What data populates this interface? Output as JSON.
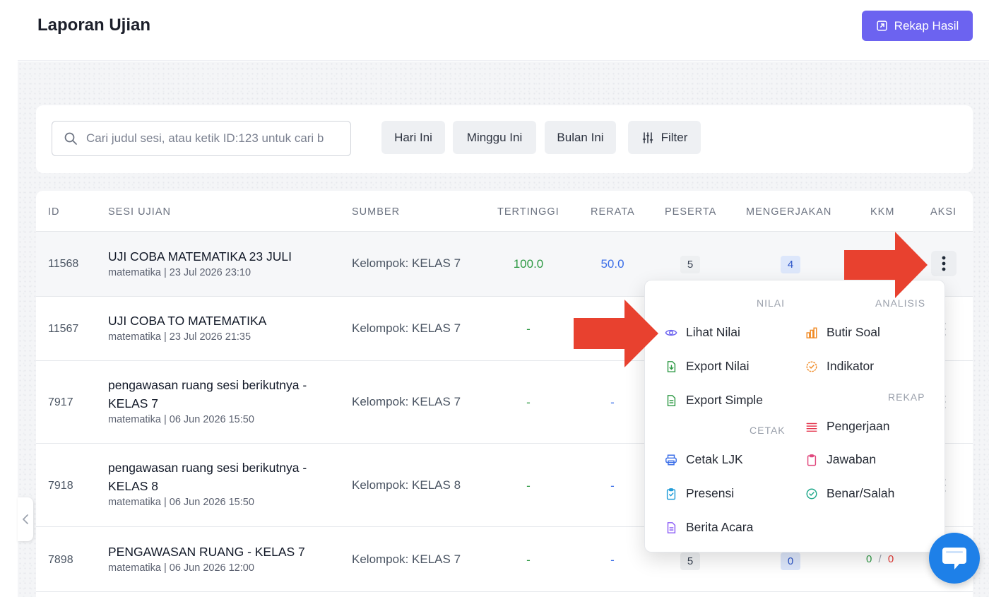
{
  "header": {
    "title": "Laporan Ujian",
    "rekap_button": "Rekap Hasil"
  },
  "filters": {
    "search_placeholder": "Cari judul sesi, atau ketik ID:123 untuk cari b",
    "chips": [
      "Hari Ini",
      "Minggu Ini",
      "Bulan Ini",
      "Filter"
    ]
  },
  "table": {
    "columns": [
      "ID",
      "SESI UJIAN",
      "SUMBER",
      "TERTINGGI",
      "RERATA",
      "PESERTA",
      "MENGERJAKAN",
      "KKM",
      "AKSI"
    ],
    "rows": [
      {
        "id": "11568",
        "title": "UJI COBA MATEMATIKA 23 JULI",
        "meta": "matematika | 23 Jul 2026 23:10",
        "source": "Kelompok: KELAS 7",
        "highest": "100.0",
        "average": "50.0",
        "participants": "5",
        "working": "4"
      },
      {
        "id": "11567",
        "title": "UJI COBA TO MATEMATIKA",
        "meta": "matematika | 23 Jul 2026 21:35",
        "source": "Kelompok: KELAS 7",
        "highest": "-"
      },
      {
        "id": "7917",
        "title": "pengawasan ruang sesi berikutnya - KELAS 7",
        "meta": "matematika | 06 Jun 2026 15:50",
        "source": "Kelompok: KELAS 7",
        "highest": "-",
        "average": "-"
      },
      {
        "id": "7918",
        "title": "pengawasan ruang sesi berikutnya - KELAS 8",
        "meta": "matematika | 06 Jun 2026 15:50",
        "source": "Kelompok: KELAS 8",
        "highest": "-",
        "average": "-"
      },
      {
        "id": "7898",
        "title": "PENGAWASAN RUANG - KELAS 7",
        "meta": "matematika | 06 Jun 2026 12:00",
        "source": "Kelompok: KELAS 7",
        "highest": "-",
        "average": "-",
        "participants": "5",
        "working": "0",
        "kkm_pass": "0",
        "kkm_sep": "/",
        "kkm_fail": "0"
      }
    ]
  },
  "menu": {
    "nilai_heading": "NILAI",
    "analisis_heading": "ANALISIS",
    "rekap_heading": "REKAP",
    "cetak_heading": "CETAK",
    "lihat_nilai": "Lihat Nilai",
    "export_nilai": "Export Nilai",
    "export_simple": "Export Simple",
    "cetak_ljk": "Cetak LJK",
    "presensi": "Presensi",
    "berita_acara": "Berita Acara",
    "butir_soal": "Butir Soal",
    "indikator": "Indikator",
    "pengerjaan": "Pengerjaan",
    "jawaban": "Jawaban",
    "benar_salah": "Benar/Salah"
  },
  "colors": {
    "primary": "#6c63f0",
    "arrow": "#e8412f",
    "green": "#2f9a45",
    "blue": "#3a6ee8",
    "chat": "#1e80e8"
  }
}
